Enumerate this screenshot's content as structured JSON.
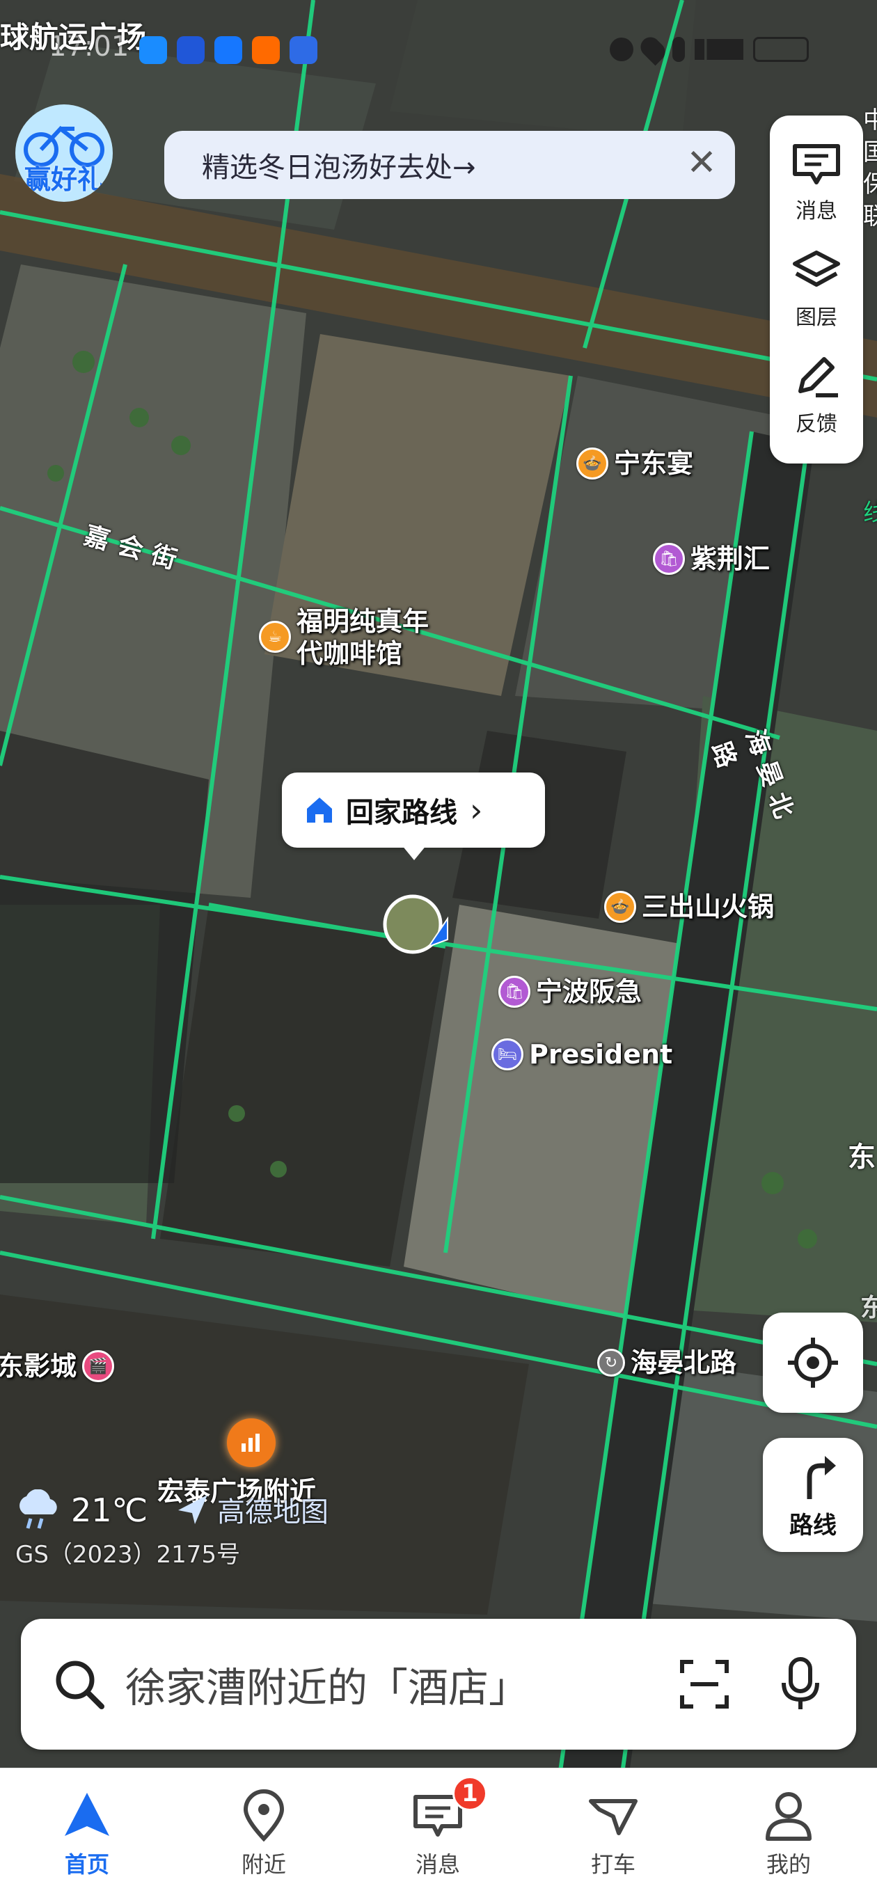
{
  "status_bar": {
    "time": "17:01",
    "overlay_text": "球航运广场",
    "app_icons": [
      "message-app-icon",
      "app-icon-2",
      "alipay-icon",
      "taobao-icon",
      "app-icon-5"
    ],
    "status_icons": [
      "alarm-icon",
      "location-icon",
      "mic-icon",
      "signal-icon",
      "battery-icon"
    ]
  },
  "promo": {
    "badge_text": "赢好礼",
    "banner_text": "精选冬日泡汤好去处→"
  },
  "right_tools": {
    "items": [
      {
        "label": "消息",
        "icon": "message-icon"
      },
      {
        "label": "图层",
        "icon": "layers-icon"
      },
      {
        "label": "反馈",
        "icon": "feedback-icon"
      }
    ],
    "edge_text": [
      "中国",
      "保",
      "联",
      "线"
    ]
  },
  "map_labels": {
    "pois": [
      {
        "name": "宁东宴",
        "icon": "restaurant-icon",
        "color": "#f59a23"
      },
      {
        "name": "紫荆汇",
        "icon": "shopping-icon",
        "color": "#b25ad3"
      },
      {
        "name": "福明纯真年",
        "name2": "代咖啡馆",
        "icon": "coffee-icon",
        "color": "#f59a23"
      },
      {
        "name": "三出山火锅",
        "icon": "restaurant-icon",
        "color": "#f59a23"
      },
      {
        "name": "宁波阪急",
        "icon": "shopping-icon",
        "color": "#b25ad3"
      },
      {
        "name": "President",
        "icon": "hotel-icon",
        "color": "#6a6ce0"
      },
      {
        "name": "东影城",
        "icon": "cinema-icon",
        "color": "#e84a7f"
      }
    ],
    "roads": [
      "嘉会街",
      "海晏北路",
      "海晏北路"
    ],
    "edge_labels": [
      "东",
      "东"
    ],
    "area_label": "宏泰广场附近"
  },
  "home_route": {
    "label": "回家路线",
    "arrow": "›"
  },
  "weather": {
    "temp": "21℃",
    "icon": "cloud-rain-icon"
  },
  "brand": {
    "name": "高德地图",
    "license": "GS（2023）2175号"
  },
  "map_controls": {
    "locate_icon": "crosshair-icon",
    "route_label": "路线"
  },
  "search": {
    "placeholder": "徐家漕附近的「酒店」"
  },
  "bottom_nav": {
    "items": [
      {
        "label": "首页",
        "icon": "home-arrow-icon",
        "active": true
      },
      {
        "label": "附近",
        "icon": "pin-icon",
        "active": false
      },
      {
        "label": "消息",
        "icon": "chat-icon",
        "active": false,
        "badge": "1"
      },
      {
        "label": "打车",
        "icon": "taxi-icon",
        "active": false
      },
      {
        "label": "我的",
        "icon": "user-icon",
        "active": false
      }
    ]
  },
  "colors": {
    "accent": "#1a6cf0",
    "road_green": "#1fd17e",
    "badge_red": "#f03a2a"
  }
}
